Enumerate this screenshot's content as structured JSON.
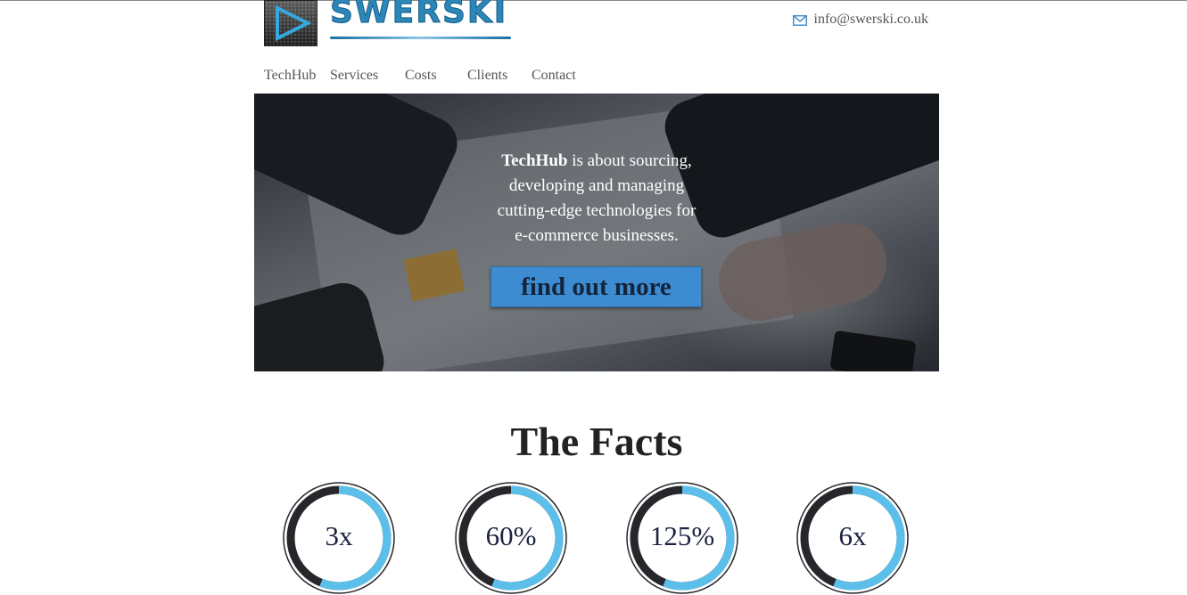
{
  "header": {
    "logo_text": "SWERSKI",
    "email": "info@swerski.co.uk",
    "email_icon": "envelope-icon"
  },
  "nav": {
    "items": [
      {
        "label": "TechHub"
      },
      {
        "label": "Services"
      },
      {
        "label": "Costs"
      },
      {
        "label": "Clients"
      },
      {
        "label": "Contact"
      }
    ]
  },
  "hero": {
    "bold": "TechHub",
    "line1_rest": " is about sourcing,",
    "line2": "developing and managing",
    "line3": "cutting-edge technologies for",
    "line4": "e-commerce businesses.",
    "cta_label": "find out more"
  },
  "facts": {
    "title": "The Facts",
    "stats": [
      {
        "value": "3x"
      },
      {
        "value": "60%"
      },
      {
        "value": "125%"
      },
      {
        "value": "6x"
      }
    ]
  },
  "colors": {
    "accent": "#3d8bd1",
    "ring_fill": "#5bbfea",
    "ring_track": "#25272b"
  }
}
